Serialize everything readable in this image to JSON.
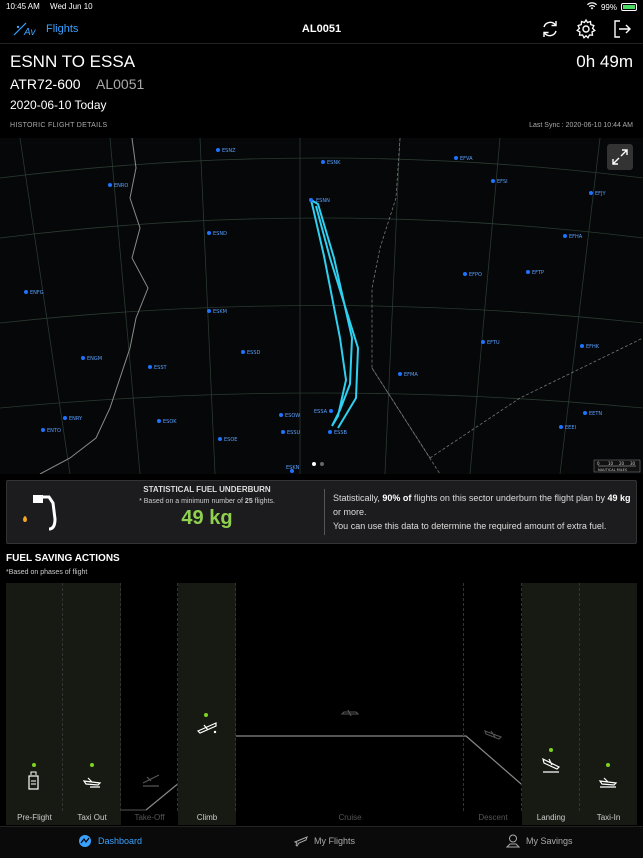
{
  "status_bar": {
    "time": "10:45 AM",
    "date": "Wed Jun 10",
    "battery": "99%"
  },
  "nav": {
    "back_label": "Flights",
    "title": "AL0051",
    "logo_text": "Av"
  },
  "flight": {
    "route": "ESNN TO ESSA",
    "duration": "0h 49m",
    "aircraft": "ATR72-600",
    "flight_number": "AL0051",
    "date": "2020-06-10 Today",
    "section_label": "HISTORIC FLIGHT DETAILS",
    "last_sync": "Last Sync : 2020-06-10 10:44 AM"
  },
  "map": {
    "airports": [
      {
        "code": "ESNZ"
      },
      {
        "code": "ESNK"
      },
      {
        "code": "EFVA"
      },
      {
        "code": "EFSI"
      },
      {
        "code": "EFJY"
      },
      {
        "code": "ENRO"
      },
      {
        "code": "ESNN"
      },
      {
        "code": "ESND"
      },
      {
        "code": "EFHA"
      },
      {
        "code": "EFPO"
      },
      {
        "code": "EFTP"
      },
      {
        "code": "ENFG"
      },
      {
        "code": "ESKM"
      },
      {
        "code": "EFTU"
      },
      {
        "code": "EFHK"
      },
      {
        "code": "ENGM"
      },
      {
        "code": "ESSD"
      },
      {
        "code": "ESST"
      },
      {
        "code": "EFMA"
      },
      {
        "code": "ENRY"
      },
      {
        "code": "ESOK"
      },
      {
        "code": "ESOW"
      },
      {
        "code": "ESSA"
      },
      {
        "code": "EETN"
      },
      {
        "code": "ENTO"
      },
      {
        "code": "ESOE"
      },
      {
        "code": "ESSU"
      },
      {
        "code": "ESSB"
      },
      {
        "code": "EEEI"
      },
      {
        "code": "ESKN"
      }
    ],
    "scale_label": "NAUTICAL MILES",
    "scale_ticks": [
      "0",
      "10",
      "20",
      "30"
    ],
    "page_count": 2,
    "current_page": 1
  },
  "fuel_card": {
    "title": "STATISTICAL FUEL UNDERBURN",
    "note_prefix": "* Based on a minimum number of ",
    "note_count": "25",
    "note_suffix": " flights.",
    "value": "49 kg",
    "text_1": "Statistically, ",
    "text_pct": "90% of",
    "text_2": " flights on this sector underburn the flight plan by ",
    "text_kg": "49 kg",
    "text_3": " or more.",
    "text_4": "You can use this data to determine the required amount of extra fuel."
  },
  "fuel_saving": {
    "title": "FUEL SAVING ACTIONS",
    "subtitle": "*Based on phases of flight",
    "phases": [
      {
        "label": "Pre-Flight",
        "active": true,
        "icon": "fuel-pump-icon"
      },
      {
        "label": "Taxi Out",
        "active": true,
        "icon": "plane-taxi-icon"
      },
      {
        "label": "Take-Off",
        "active": false,
        "icon": "plane-takeoff-icon"
      },
      {
        "label": "Climb",
        "active": true,
        "icon": "plane-climb-icon"
      },
      {
        "label": "Cruise",
        "active": false,
        "icon": "plane-cruise-icon"
      },
      {
        "label": "Descent",
        "active": false,
        "icon": "plane-descent-icon"
      },
      {
        "label": "Landing",
        "active": true,
        "icon": "plane-landing-icon"
      },
      {
        "label": "Taxi-In",
        "active": true,
        "icon": "plane-taxi-in-icon"
      }
    ]
  },
  "tabs": [
    {
      "label": "Dashboard",
      "active": true,
      "icon": "dashboard-icon"
    },
    {
      "label": "My Flights",
      "active": false,
      "icon": "plane-icon"
    },
    {
      "label": "My Savings",
      "active": false,
      "icon": "savings-icon"
    }
  ],
  "colors": {
    "accent": "#39a2ff",
    "track": "#2fd0f0",
    "positive": "#7ed321"
  }
}
